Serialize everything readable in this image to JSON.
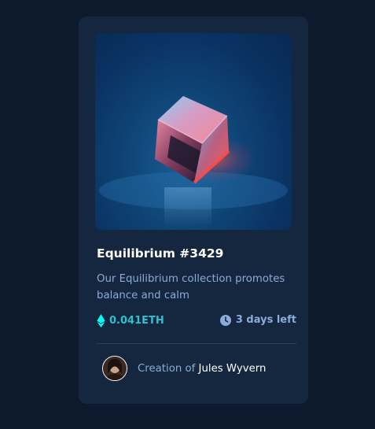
{
  "card": {
    "title": "Equilibrium #3429",
    "description": "Our Equilibrium collection promotes balance and calm",
    "price": "0.041ETH",
    "time_left": "3 days left",
    "creator_prefix": "Creation of",
    "creator_name": "Jules Wyvern"
  },
  "icons": {
    "price": "ethereum-icon",
    "time": "clock-icon"
  },
  "colors": {
    "page_background": "#0d192c",
    "card_background": "#15263f",
    "primary_text": "#ffffff",
    "secondary_text": "#8bacd9",
    "accent_cyan": "#2cc1cc",
    "divider": "#2e405a"
  }
}
